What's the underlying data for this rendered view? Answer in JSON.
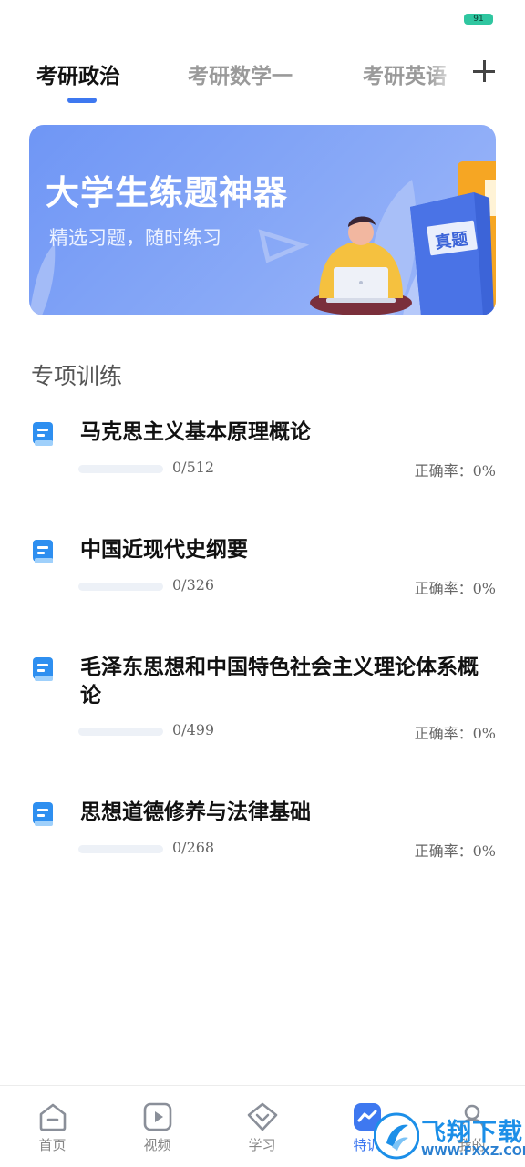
{
  "status_bar": {
    "battery": "91"
  },
  "tabs": [
    {
      "label": "考研政治",
      "active": true
    },
    {
      "label": "考研数学一",
      "active": false
    },
    {
      "label": "考研英语",
      "active": false
    }
  ],
  "banner": {
    "title": "大学生练题神器",
    "subtitle": "精选习题，随时练习",
    "book_label": "真题"
  },
  "section_title": "专项训练",
  "accuracy_label": "正确率：",
  "topics": [
    {
      "title": "马克思主义基本原理概论",
      "progress": "0/512",
      "done": 0,
      "total": 512,
      "accuracy": "0%"
    },
    {
      "title": "中国近现代史纲要",
      "progress": "0/326",
      "done": 0,
      "total": 326,
      "accuracy": "0%"
    },
    {
      "title": "毛泽东思想和中国特色社会主义理论体系概论",
      "progress": "0/499",
      "done": 0,
      "total": 499,
      "accuracy": "0%"
    },
    {
      "title": "思想道德修养与法律基础",
      "progress": "0/268",
      "done": 0,
      "total": 268,
      "accuracy": "0%"
    }
  ],
  "bottom_nav": [
    {
      "label": "首页",
      "icon": "home-icon",
      "active": false
    },
    {
      "label": "视频",
      "icon": "video-play-icon",
      "active": false
    },
    {
      "label": "学习",
      "icon": "study-diamond-icon",
      "active": false
    },
    {
      "label": "特训",
      "icon": "training-chart-icon",
      "active": true
    },
    {
      "label": "我的",
      "icon": "profile-icon",
      "active": false
    }
  ],
  "watermark": {
    "text": "飞翔下载",
    "url": "WWW.FXXZ.COM"
  },
  "colors": {
    "accent": "#3e78f0",
    "banner": "#7c9ff6",
    "battery": "#2fc6a0"
  }
}
